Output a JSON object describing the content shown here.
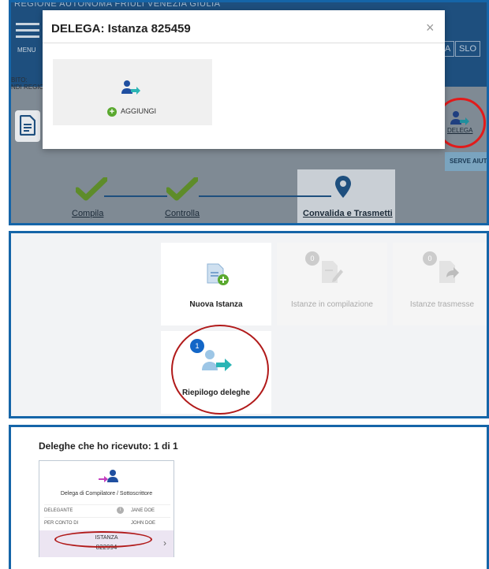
{
  "panel1": {
    "region_text": "REGIONE AUTONOMA FRIULI VENEZIA GIULIA",
    "menu_label": "MENU",
    "lang_a": "A",
    "lang_slo": "SLO",
    "ambito_line1": "BITO:",
    "ambito_line2": "NDI REGIO",
    "delega_label": "DELEGA",
    "serve_label": "SERVE AIUTO",
    "steps": [
      {
        "label": "Compila",
        "state": "done"
      },
      {
        "label": "Controlla",
        "state": "done"
      },
      {
        "label": "Convalida e Trasmetti",
        "state": "active"
      }
    ],
    "modal": {
      "title": "DELEGA: Istanza 825459",
      "close": "×",
      "add_label": "AGGIUNGI"
    }
  },
  "panel2": {
    "tiles": [
      {
        "label": "Nuova Istanza",
        "badge": ""
      },
      {
        "label": "Istanze in compilazione",
        "badge": "0"
      },
      {
        "label": "Istanze trasmesse",
        "badge": "0"
      },
      {
        "label": "Riepilogo deleghe",
        "badge": "1"
      }
    ]
  },
  "panel3": {
    "heading": "Deleghe che ho ricevuto: 1 di 1",
    "card_title": "Delega di Compilatore / Sottoscrittore",
    "delegante_key": "DELEGANTE",
    "delegante_val": "JANE DOE",
    "perconto_key": "PER CONTO DI",
    "perconto_val": "JOHN DOE",
    "istanza_label": "ISTANZA",
    "istanza_num": "822994",
    "chevron": "›"
  },
  "colors": {
    "brand_blue": "#1565a8",
    "check_green": "#6aaa2a",
    "teal_arrow": "#2bb5b5",
    "person_blue": "#1f4fa0",
    "annotation_red": "#e21b1b"
  }
}
